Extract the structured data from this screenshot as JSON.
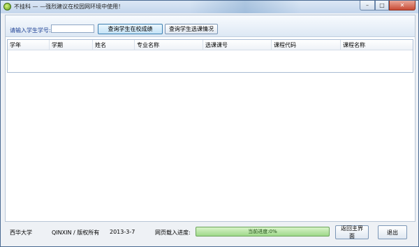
{
  "window": {
    "title": "不挂科   — —强烈建议在校园网环境中使用！",
    "controls": {
      "minimize": "–",
      "maximize": "□",
      "close": "✕"
    }
  },
  "toolbar": {
    "label": "请输入学生学号:",
    "input_value": "",
    "query_grades_button": "查询学生在校成绩",
    "query_courses_button": "查询学生选课情况"
  },
  "table": {
    "columns": [
      "学年",
      "学期",
      "姓名",
      "专业名称",
      "选课课号",
      "课程代码",
      "课程名称"
    ],
    "rows": []
  },
  "footer": {
    "school": "西华大学",
    "copyright": "QINXIN / 版权所有",
    "date": "2013-3-7",
    "progress_label": "网页载入进度:",
    "progress_text": "当前进度:0%",
    "progress_value": 0,
    "home_button": "返回主界面",
    "exit_button": "退出"
  },
  "colors": {
    "label_blue": "#1c3f94",
    "progress_green": "#9fd88a",
    "close_red": "#c84a34"
  }
}
